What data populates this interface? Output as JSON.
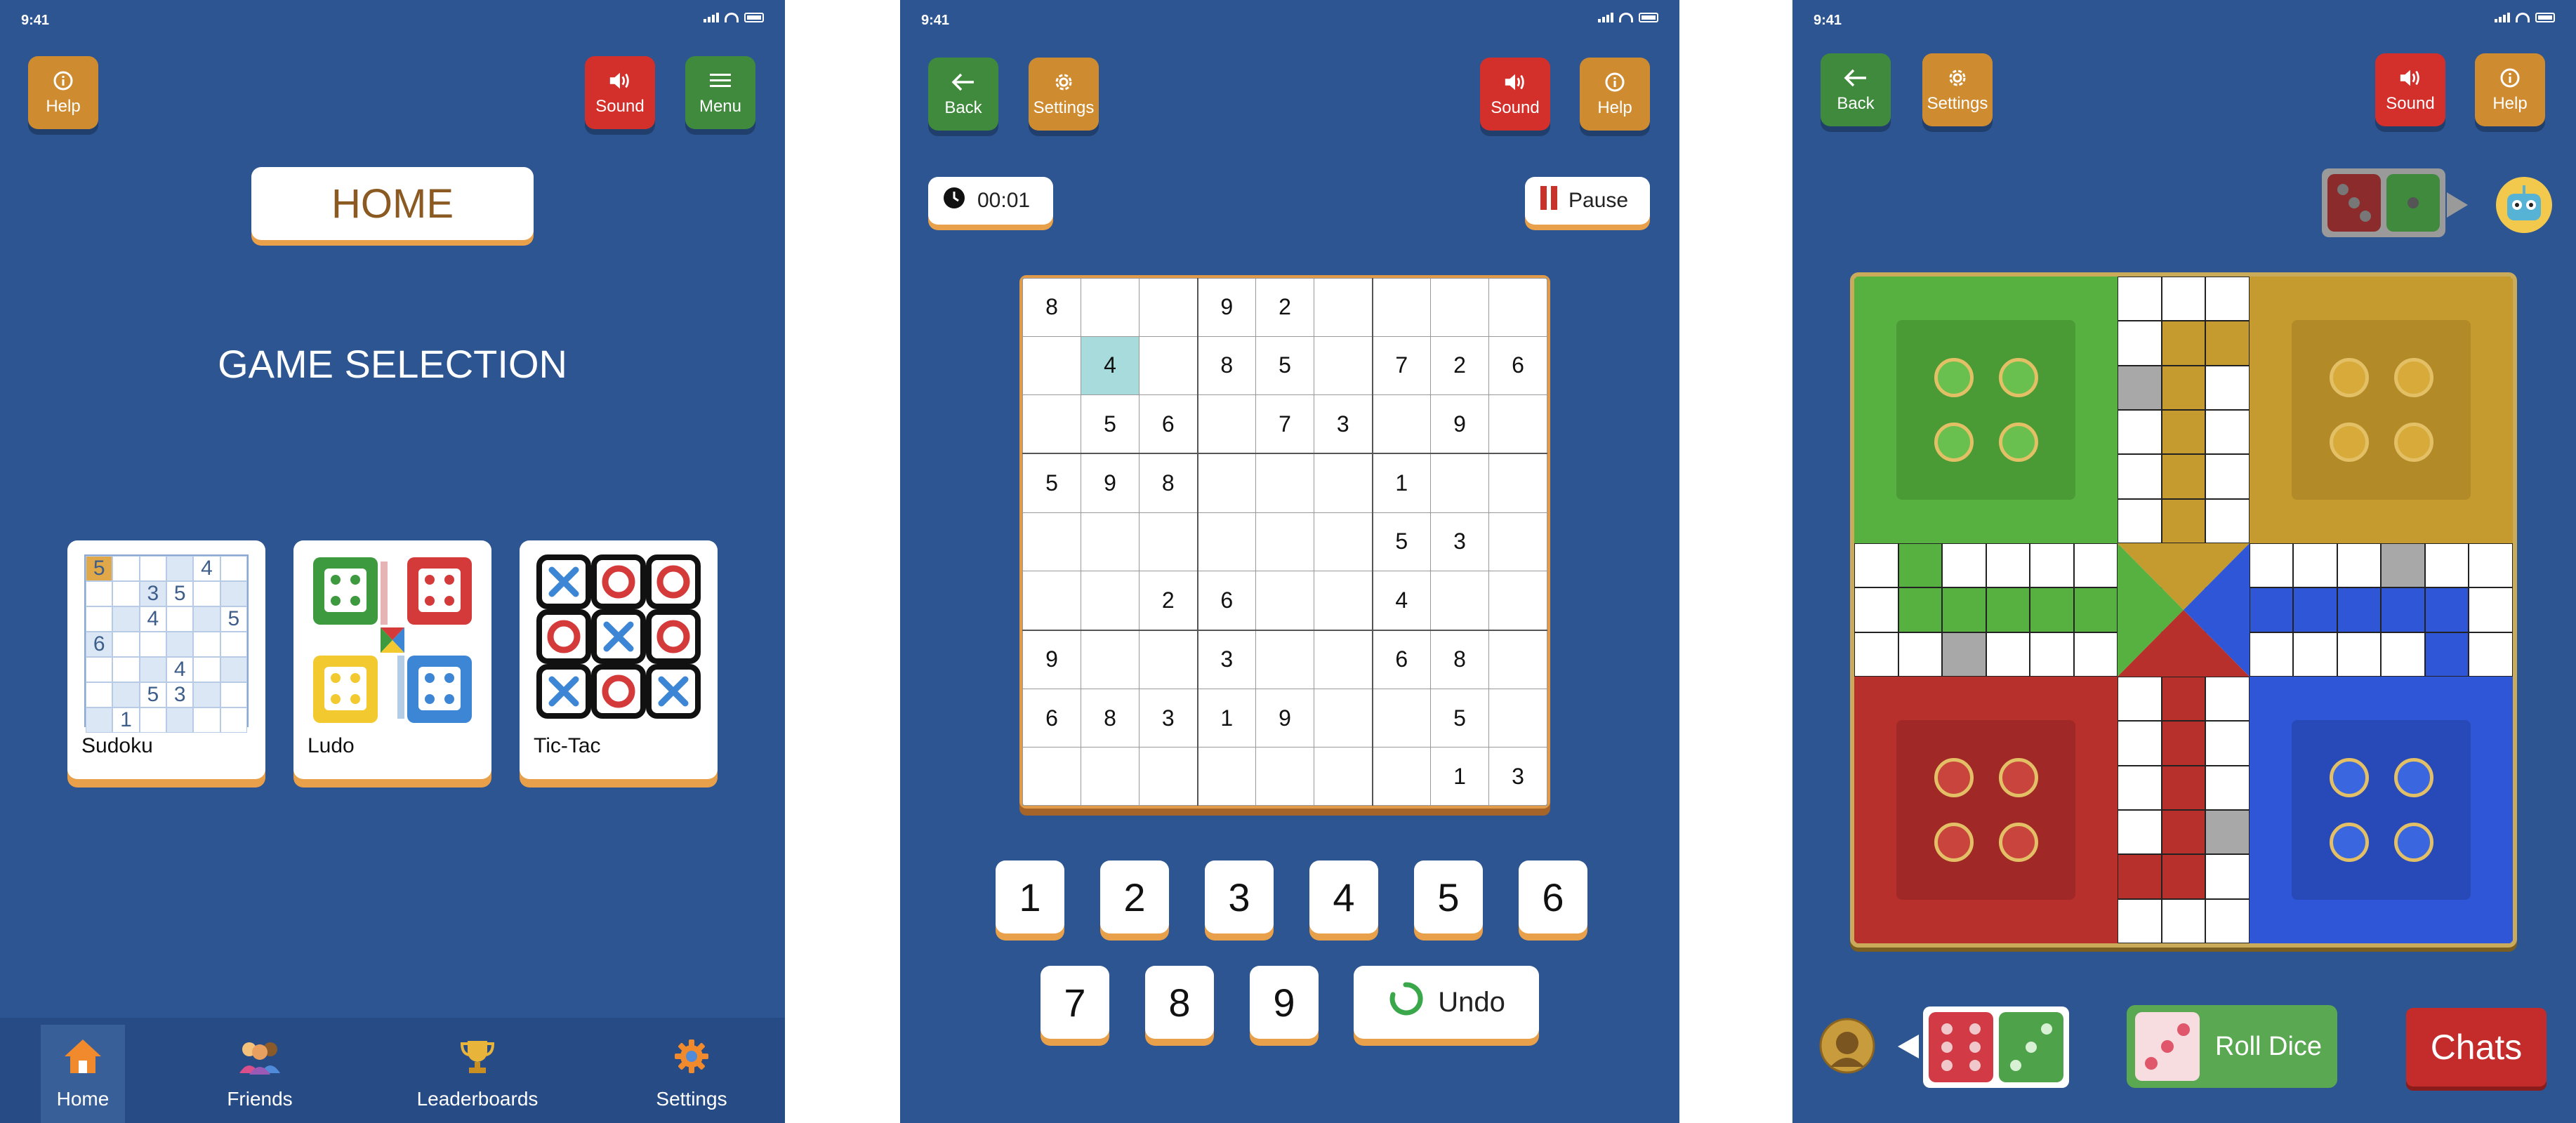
{
  "status_bar": {
    "time": "9:41"
  },
  "colors": {
    "background": "#2c5591",
    "green_button": "#3f8a3c",
    "orange_button": "#cf8b2f",
    "red_button": "#d4302b",
    "accent_shadow": "#e8a04a"
  },
  "home_screen": {
    "help_label": "Help",
    "sound_label": "Sound",
    "menu_label": "Menu",
    "title": "HOME",
    "section_title": "GAME SELECTION",
    "games": [
      {
        "label": "Sudoku",
        "icon": "sudoku-thumbnail"
      },
      {
        "label": "Ludo",
        "icon": "ludo-thumbnail"
      },
      {
        "label": "Tic-Tac",
        "icon": "tictactoe-thumbnail"
      }
    ],
    "sudoku_thumb": [
      [
        "5",
        "",
        "",
        "",
        "4",
        ""
      ],
      [
        "",
        "",
        "3",
        "5",
        "",
        ""
      ],
      [
        "",
        "",
        "4",
        "",
        "",
        "5"
      ],
      [
        "6",
        "",
        "",
        "",
        "",
        ""
      ],
      [
        "",
        "",
        "",
        "4",
        "",
        ""
      ],
      [
        "",
        "",
        "5",
        "3",
        "",
        ""
      ],
      [
        "",
        "1",
        "",
        "",
        "",
        ""
      ]
    ],
    "nav": [
      {
        "label": "Home",
        "icon": "home-icon"
      },
      {
        "label": "Friends",
        "icon": "friends-icon"
      },
      {
        "label": "Leaderboards",
        "icon": "trophy-icon"
      },
      {
        "label": "Settings",
        "icon": "gear-icon"
      }
    ]
  },
  "sudoku_screen": {
    "back_label": "Back",
    "settings_label": "Settings",
    "sound_label": "Sound",
    "help_label": "Help",
    "timer": "00:01",
    "pause_label": "Pause",
    "grid": [
      [
        "8",
        "",
        "",
        "9",
        "2",
        "",
        "",
        "",
        ""
      ],
      [
        "",
        "4",
        "",
        "8",
        "5",
        "",
        "7",
        "2",
        "6"
      ],
      [
        "",
        "5",
        "6",
        "",
        "7",
        "3",
        "",
        "9",
        ""
      ],
      [
        "5",
        "9",
        "8",
        "",
        "",
        "",
        "1",
        "",
        ""
      ],
      [
        "",
        "",
        "",
        "",
        "",
        "",
        "5",
        "3",
        ""
      ],
      [
        "",
        "",
        "2",
        "6",
        "",
        "",
        "4",
        "",
        ""
      ],
      [
        "9",
        "",
        "",
        "3",
        "",
        "",
        "6",
        "8",
        ""
      ],
      [
        "6",
        "8",
        "3",
        "1",
        "9",
        "",
        "",
        "5",
        ""
      ],
      [
        "",
        "",
        "",
        "",
        "",
        "",
        "",
        "1",
        "3"
      ]
    ],
    "selected_cell": [
      1,
      1
    ],
    "number_keys": [
      "1",
      "2",
      "3",
      "4",
      "5",
      "6",
      "7",
      "8",
      "9"
    ],
    "undo_label": "Undo"
  },
  "ludo_screen": {
    "back_label": "Back",
    "settings_label": "Settings",
    "sound_label": "Sound",
    "help_label": "Help",
    "roll_dice_label": "Roll Dice",
    "chats_label": "Chats",
    "top_dice": [
      3,
      1
    ],
    "bottom_dice": [
      6,
      3
    ],
    "roll_dice_face": 3
  }
}
